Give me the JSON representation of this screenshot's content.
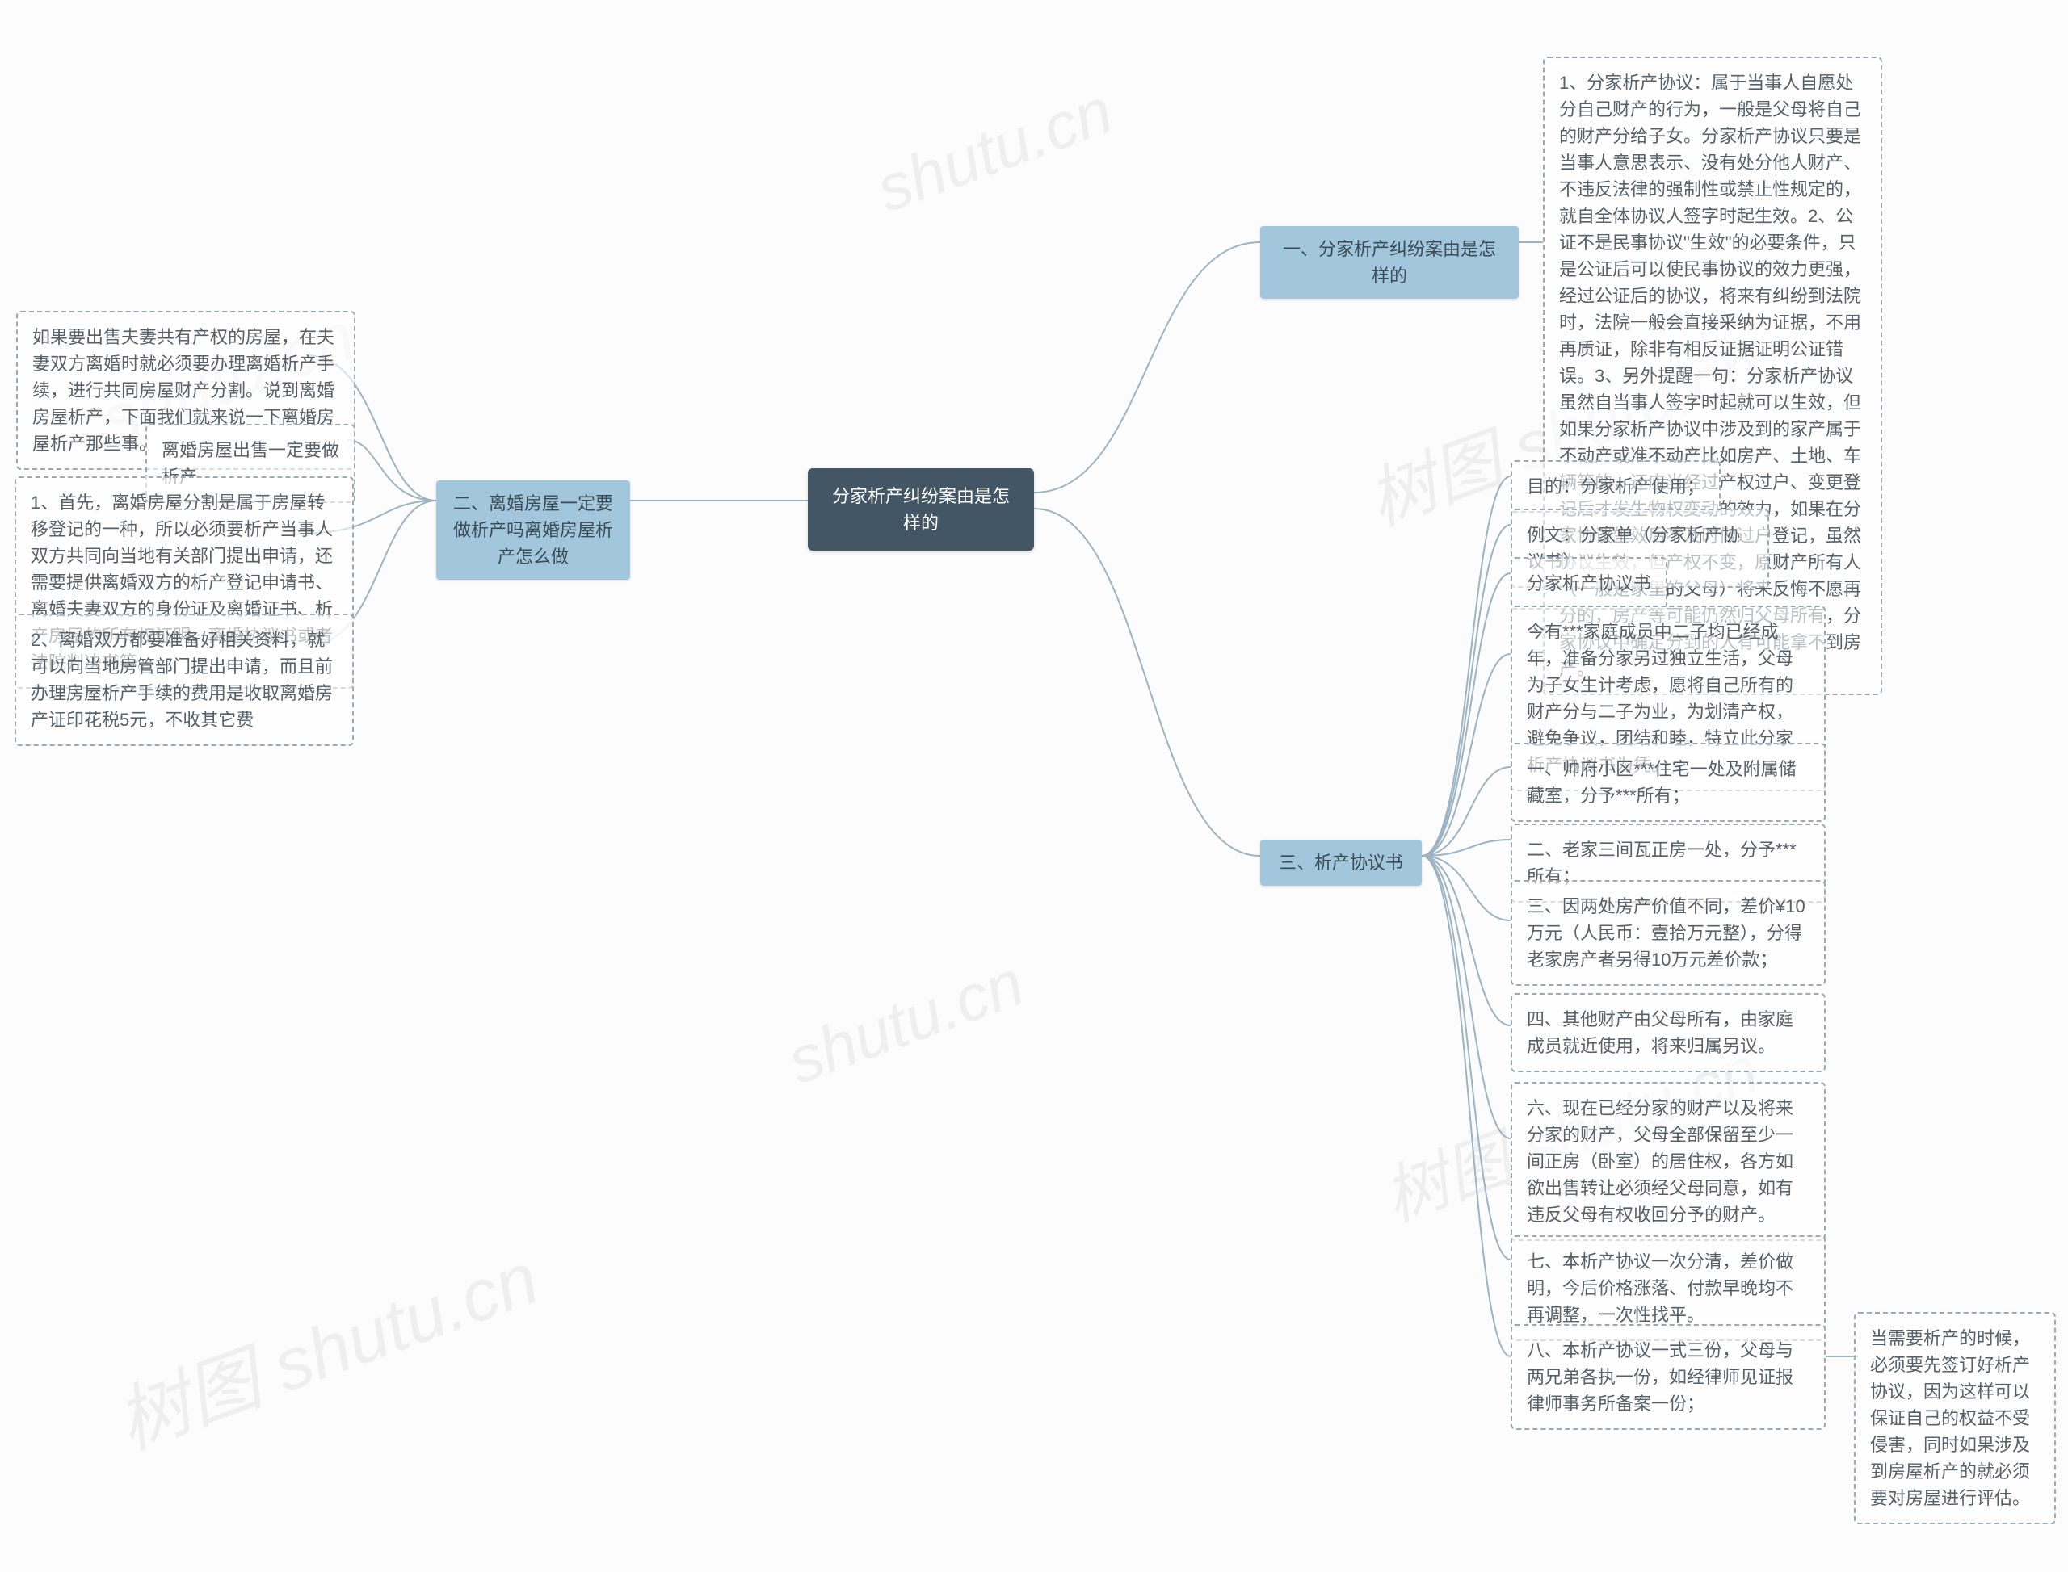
{
  "watermarks": {
    "w1": "shutu.cn",
    "w2": "shutu.cn",
    "w3": "树图 shutu.cn",
    "w4": "shutu.cn",
    "w5": "树图 shutu.cn",
    "w6": "树图 shutu.cn"
  },
  "root": {
    "title": "分家析产纠纷案由是怎样的"
  },
  "branch1": {
    "title": "一、分家析产纠纷案由是怎样的",
    "leaf1": "1、分家析产协议：属于当事人自愿处分自己财产的行为，一般是父母将自己的财产分给子女。分家析产协议只要是当事人意思表示、没有处分他人财产、不违反法律的强制性或禁止性规定的，就自全体协议人签字时起生效。2、公证不是民事协议\"生效\"的必要条件，只是公证后可以使民事协议的效力更强，经过公证后的协议，将来有纠纷到法院时，法院一般会直接采纳为证据，不用再质证，除非有相反证据证明公证错误。3、另外提醒一句：分家析产协议虽然自当事人签字时起就可以生效，但如果分家析产协议中涉及到的家产属于不动产或准不动产比如房产、土地、车辆等的，还应当经过产权过户、变更登记后才发生物权变动的效力，如果在分家协议生效后不及时做过户登记，虽然协议生效，但产权不变，原财产所有人（一般是家里的父母）将来反悔不愿再分的，房产等可能仍然归父母所有，分家协议中确定分到的人有可能拿不到房产。"
  },
  "branch2": {
    "title": "二、离婚房屋一定要做析产吗离婚房屋析产怎么做",
    "intro": "如果要出售夫妻共有产权的房屋，在夫妻双方离婚时就必须要办理离婚析产手续，进行共同房屋财产分割。说到离婚房屋析产，下面我们就来说一下离婚房屋析产那些事。",
    "sub": "离婚房屋出售一定要做析产",
    "leaf1": "1、首先，离婚房屋分割是属于房屋转移登记的一种，所以必须要析产当事人双方共同向当地有关部门提出申请，还需要提供离婚双方的析产登记申请书、离婚夫妻双方的身份证及离婚证书、析产房屋的所有权证明、离婚协议书或者法院判决书等。",
    "leaf2": "2、离婚双方都要准备好相关资料，就可以向当地房管部门提出申请，而且前办理房屋析产手续的费用是收取离婚房产证印花税5元，不收其它费"
  },
  "branch3": {
    "title": "三、析产协议书",
    "item1": "目的：分家析产使用；",
    "item2": "例文：分家单（分家析产协议书）",
    "item3": "分家析产协议书",
    "item4": "今有***家庭成员中二子均已经成年，准备分家另过独立生活，父母为子女生计考虑，愿将自己所有的财产分与二子为业，为划清产权，避免争议，团结和睦，特立此分家析产协议书为凭。",
    "item5": "一、帅府小区***住宅一处及附属储藏室，分予***所有；",
    "item6": "二、老家三间瓦正房一处，分予***所有；",
    "item7": "三、因两处房产价值不同，差价¥10万元（人民币：壹拾万元整），分得老家房产者另得10万元差价款；",
    "item8": "四、其他财产由父母所有，由家庭成员就近使用，将来归属另议。",
    "item9": "六、现在已经分家的财产以及将来分家的财产，父母全部保留至少一间正房（卧室）的居住权，各方如欲出售转让必须经父母同意，如有违反父母有权收回分予的财产。",
    "item10": "七、本析产协议一次分清，差价做明，今后价格涨落、付款早晚均不再调整，一次性找平。",
    "item11": "八、本析产协议一式三份，父母与两兄弟各执一份，如经律师见证报律师事务所备案一份；",
    "conclusion": "当需要析产的时候，必须要先签订好析产协议，因为这样可以保证自己的权益不受侵害，同时如果涉及到房屋析产的就必须要对房屋进行评估。"
  }
}
